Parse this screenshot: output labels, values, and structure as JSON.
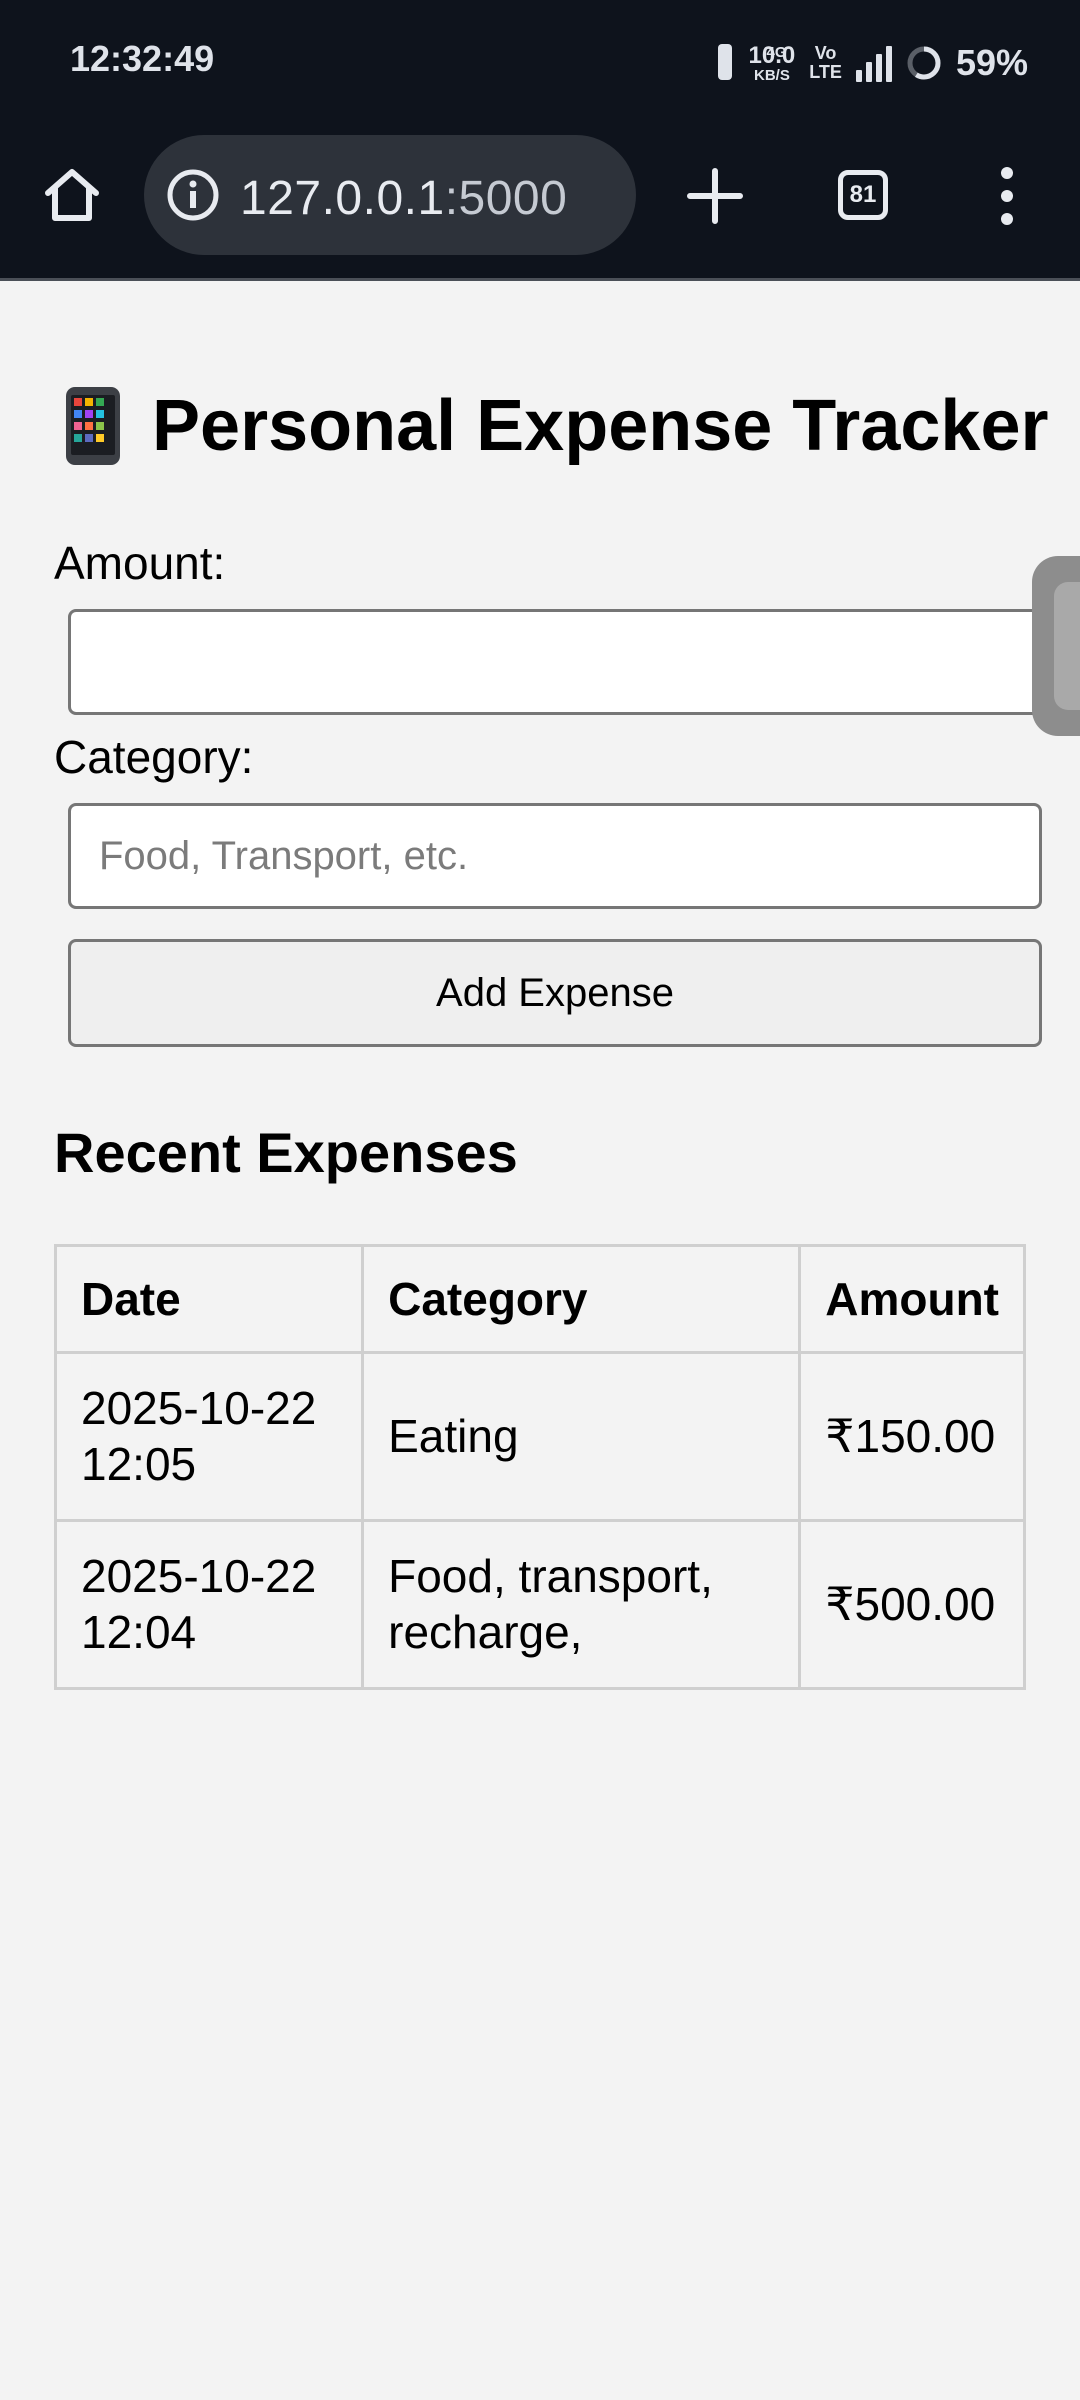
{
  "status_bar": {
    "time": "12:32:49",
    "net_speed_value": "10.0",
    "net_speed_unit": "KB/S",
    "volte_top": "Vo",
    "volte_bottom": "LTE",
    "network_type": "4G",
    "battery_percent": "59%",
    "signal_bars": 4
  },
  "browser": {
    "url_host": "127.0.0.1",
    "url_port": ":5000",
    "tab_count": "81",
    "icons": [
      "home-icon",
      "info-icon",
      "plus-icon",
      "tabs-icon",
      "more-vert-icon"
    ]
  },
  "page": {
    "title_emoji": "mobile-phone-icon",
    "title": "Personal Expense Tracker",
    "form": {
      "amount_label": "Amount:",
      "amount_value": "",
      "category_label": "Category:",
      "category_placeholder": "Food, Transport, etc.",
      "category_value": "",
      "submit_label": "Add Expense"
    },
    "recent": {
      "heading": "Recent Expenses",
      "columns": [
        "Date",
        "Category",
        "Amount"
      ],
      "rows": [
        {
          "date": "2025-10-22 12:05",
          "category": "Eating",
          "amount": "₹150.00"
        },
        {
          "date": "2025-10-22 12:04",
          "category": "Food, transport, recharge,",
          "amount": "₹500.00"
        }
      ]
    }
  }
}
